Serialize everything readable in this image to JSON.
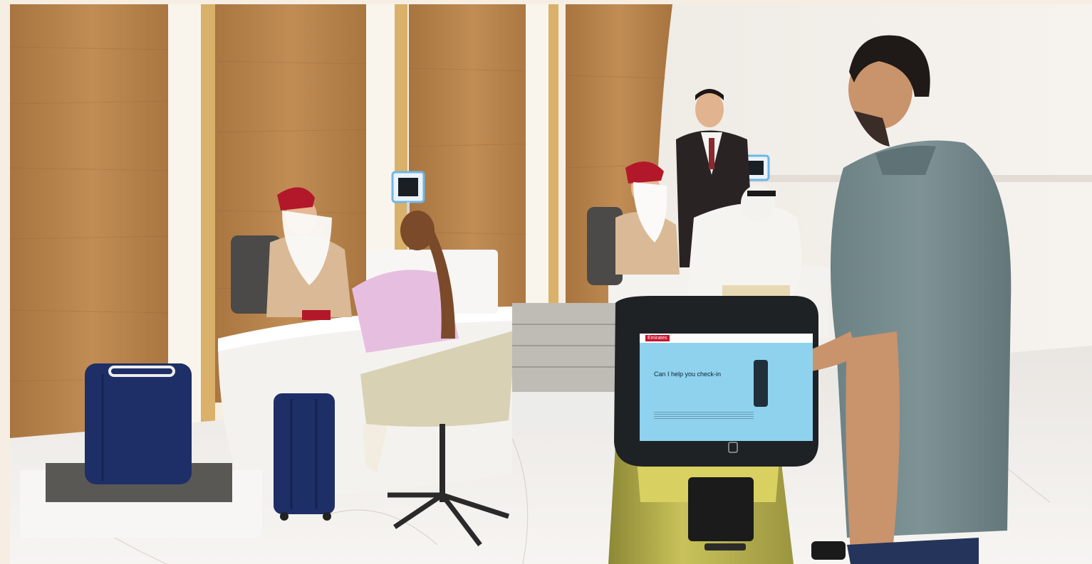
{
  "kiosk": {
    "brand": "Emirates",
    "prompt": "Can I help you check-in"
  },
  "colors": {
    "wood": "#b7824a",
    "wood_dark": "#94643a",
    "marble": "#efece8",
    "wall": "#f3efe9",
    "crew_hat": "#b3182a",
    "crew_uniform": "#d9b996",
    "polo": "#74898c",
    "kiosk_screen": "#8fd2ee",
    "kiosk_base": "#b7b04a",
    "luggage": "#1e2f68"
  },
  "icons": [
    "face-scanner-icon",
    "luggage-icon",
    "watch-icon"
  ]
}
